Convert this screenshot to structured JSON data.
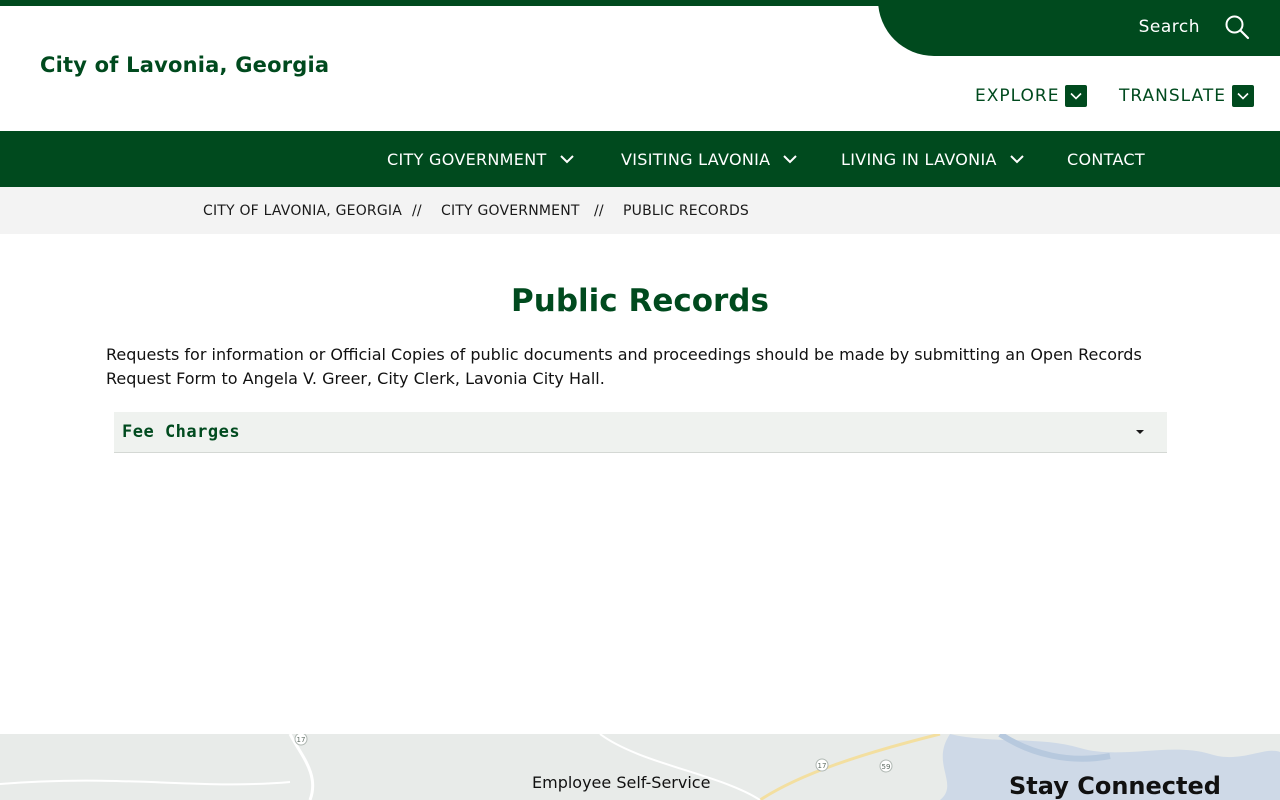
{
  "header": {
    "site_title": "City of Lavonia, Georgia",
    "search_label": "Search",
    "explore_label": "EXPLORE",
    "translate_label": "TRANSLATE"
  },
  "nav": {
    "items": [
      {
        "label": "CITY GOVERNMENT",
        "icon": "chevron-down-icon"
      },
      {
        "label": "VISITING LAVONIA",
        "icon": "chevron-down-icon"
      },
      {
        "label": "LIVING IN LAVONIA",
        "icon": "chevron-down-icon"
      },
      {
        "label": "CONTACT"
      }
    ]
  },
  "breadcrumb": {
    "items": [
      "CITY OF LAVONIA, GEORGIA",
      "CITY GOVERNMENT",
      "PUBLIC RECORDS"
    ],
    "separator": "//"
  },
  "main": {
    "title": "Public Records",
    "intro": "Requests for information or Official Copies of public documents and proceedings should be made by submitting an Open Records Request Form to Angela V. Greer, City Clerk, Lavonia City Hall.",
    "accordion_title": "Fee Charges"
  },
  "footer": {
    "link": "Employee Self-Service",
    "stay_connected": "Stay Connected",
    "map_labels": [
      "17",
      "17",
      "59",
      "59"
    ]
  },
  "colors": {
    "brand_green": "#004a1e",
    "breadcrumb_bg": "#f3f3f3",
    "accordion_bg": "#eff2ef"
  }
}
